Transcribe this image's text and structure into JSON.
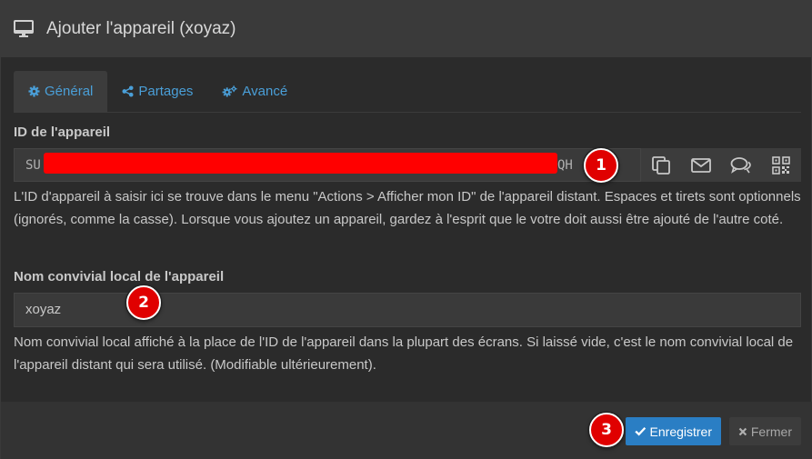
{
  "dialog": {
    "title": "Ajouter l'appareil (xoyaz)"
  },
  "tabs": [
    {
      "label": "Général",
      "icon": "gear-icon",
      "active": true
    },
    {
      "label": "Partages",
      "icon": "share-icon",
      "active": false
    },
    {
      "label": "Avancé",
      "icon": "gears-icon",
      "active": false
    }
  ],
  "device_id": {
    "label": "ID de l'appareil",
    "value_prefix": "SU",
    "value_suffix": "QH",
    "actions": [
      {
        "icon": "copy-icon"
      },
      {
        "icon": "email-icon"
      },
      {
        "icon": "chat-icon"
      },
      {
        "icon": "qr-code-icon"
      }
    ],
    "help": "L'ID d'appareil à saisir ici se trouve dans le menu \"Actions > Afficher mon ID\" de l'appareil distant. Espaces et tirets sont optionnels (ignorés, comme la casse). Lorsque vous ajoutez un appareil, gardez à l'esprit que le votre doit aussi être ajouté de l'autre coté."
  },
  "device_name": {
    "label": "Nom convivial local de l'appareil",
    "value": "xoyaz",
    "help": "Nom convivial local affiché à la place de l'ID de l'appareil dans la plupart des écrans. Si laissé vide, c'est le nom convivial local de l'appareil distant qui sera utilisé. (Modifiable ultérieurement)."
  },
  "footer": {
    "save_label": "Enregistrer",
    "close_label": "Fermer"
  },
  "annotations": [
    "1",
    "2",
    "3"
  ],
  "colors": {
    "accent": "#2a7ec4",
    "link": "#4a9fd8",
    "badge": "#e00000",
    "redaction": "#ff0000"
  }
}
